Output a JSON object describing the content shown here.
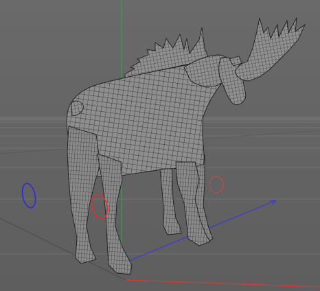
{
  "viewport": {
    "background_color": "#626262",
    "grid_color": "#7a7a7a",
    "horizon_color": "#707070"
  },
  "axes": {
    "x_color": "#d23b3b",
    "y_color": "#2ea64a",
    "z_color": "#3a3ad8"
  },
  "model": {
    "name": "moose-wireframe-mesh",
    "body_fill": "#8e8e8e",
    "wire_color": "#1e1e1e"
  },
  "handles": {
    "blue_color": "#2b2bdc",
    "red_color": "#e03030",
    "red_dashed_color": "#e04848"
  }
}
